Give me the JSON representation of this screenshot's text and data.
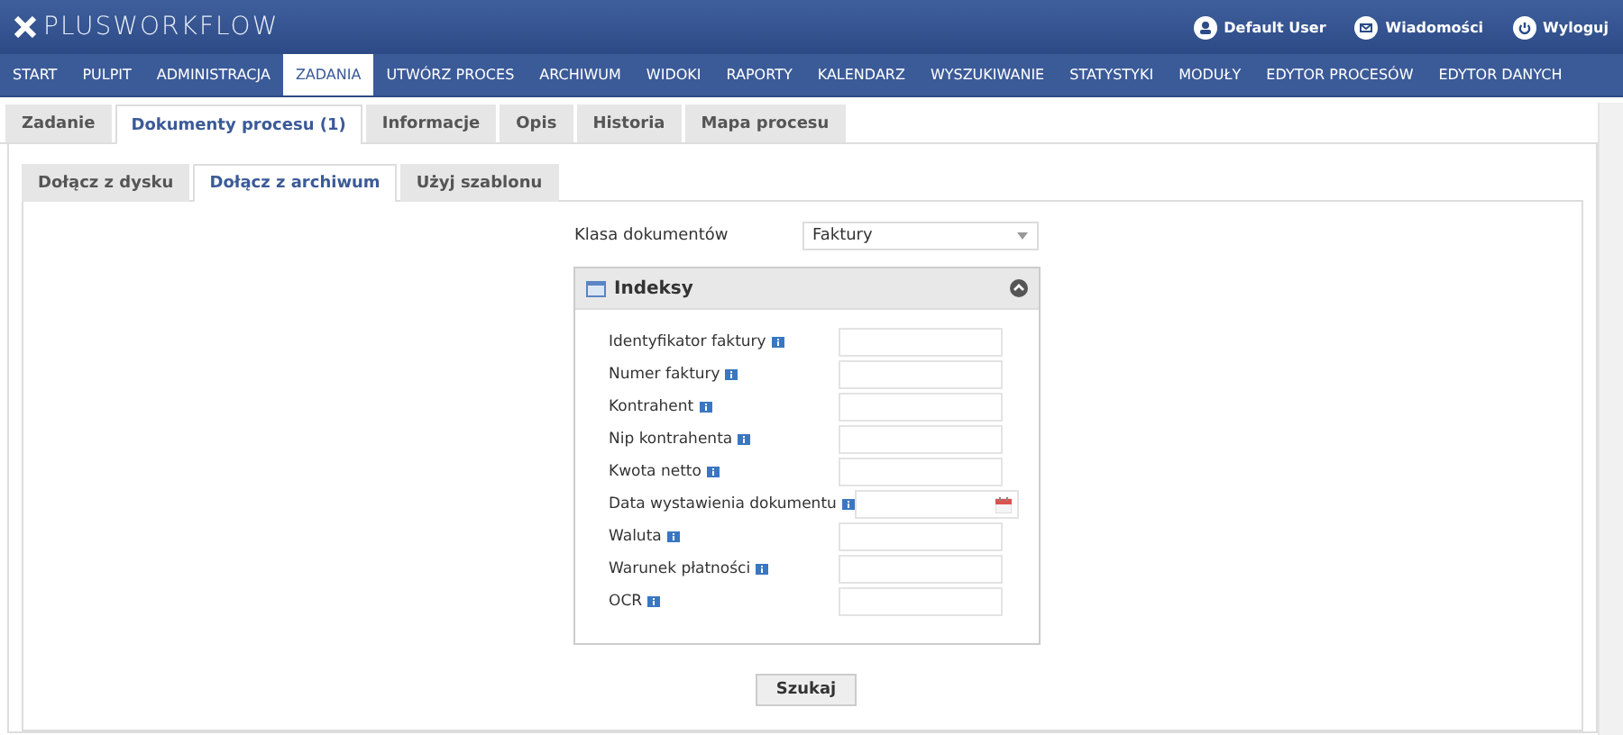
{
  "header": {
    "logo": "PLUSWORKFLOW",
    "user_links": [
      {
        "kind": "user",
        "label": "Default User"
      },
      {
        "kind": "messages",
        "label": "Wiadomości"
      },
      {
        "kind": "logout",
        "label": "Wyloguj"
      }
    ]
  },
  "nav": [
    {
      "label": "START",
      "selected": false
    },
    {
      "label": "PULPIT",
      "selected": false
    },
    {
      "label": "ADMINISTRACJA",
      "selected": false
    },
    {
      "label": "ZADANIA",
      "selected": true
    },
    {
      "label": "UTWÓRZ PROCES",
      "selected": false
    },
    {
      "label": "ARCHIWUM",
      "selected": false
    },
    {
      "label": "WIDOKI",
      "selected": false
    },
    {
      "label": "RAPORTY",
      "selected": false
    },
    {
      "label": "KALENDARZ",
      "selected": false
    },
    {
      "label": "WYSZUKIWANIE",
      "selected": false
    },
    {
      "label": "STATYSTYKI",
      "selected": false
    },
    {
      "label": "MODUŁY",
      "selected": false
    },
    {
      "label": "EDYTOR PROCESÓW",
      "selected": false
    },
    {
      "label": "EDYTOR DANYCH",
      "selected": false
    }
  ],
  "tabs": [
    {
      "label": "Zadanie",
      "selected": false
    },
    {
      "label": "Dokumenty procesu (1)",
      "selected": true
    },
    {
      "label": "Informacje",
      "selected": false
    },
    {
      "label": "Opis",
      "selected": false
    },
    {
      "label": "Historia",
      "selected": false
    },
    {
      "label": "Mapa procesu",
      "selected": false
    }
  ],
  "subtabs": [
    {
      "label": "Dołącz z dysku",
      "selected": false
    },
    {
      "label": "Dołącz z archiwum",
      "selected": true
    },
    {
      "label": "Użyj szablonu",
      "selected": false
    }
  ],
  "document_class": {
    "label": "Klasa dokumentów",
    "value": "Faktury"
  },
  "indexes": {
    "title": "Indeksy",
    "expanded": true,
    "fields": [
      {
        "label": "Identyfikator faktury",
        "kind": "text"
      },
      {
        "label": "Numer faktury",
        "kind": "text"
      },
      {
        "label": "Kontrahent",
        "kind": "text"
      },
      {
        "label": "Nip kontrahenta",
        "kind": "text"
      },
      {
        "label": "Kwota netto",
        "kind": "text"
      },
      {
        "label": "Data wystawienia dokumentu",
        "kind": "date"
      },
      {
        "label": "Waluta",
        "kind": "text"
      },
      {
        "label": "Warunek płatności",
        "kind": "text"
      },
      {
        "label": "OCR",
        "kind": "text"
      }
    ]
  },
  "search_button": "Szukaj"
}
